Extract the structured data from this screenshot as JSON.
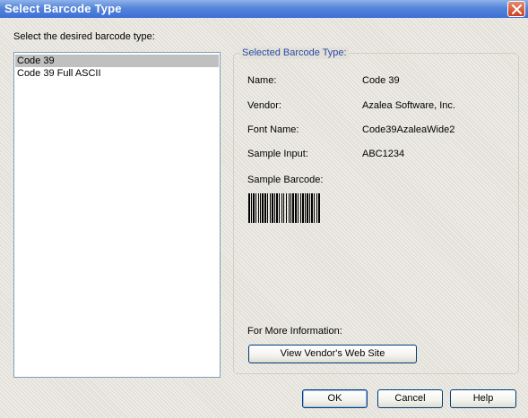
{
  "window": {
    "title": "Select Barcode Type"
  },
  "prompt": "Select the desired barcode type:",
  "barcode_list": {
    "items": [
      "Code 39",
      "Code 39 Full ASCII"
    ],
    "selected_index": 0
  },
  "details": {
    "group_title": "Selected Barcode Type:",
    "name_label": "Name:",
    "name_value": "Code 39",
    "vendor_label": "Vendor:",
    "vendor_value": "Azalea Software, Inc.",
    "font_label": "Font Name:",
    "font_value": "Code39AzaleaWide2",
    "sample_input_label": "Sample Input:",
    "sample_input_value": "ABC1234",
    "sample_barcode_label": "Sample Barcode:",
    "more_info_label": "For More Information:",
    "vendor_site_button": "View Vendor's Web Site"
  },
  "buttons": {
    "ok": "OK",
    "cancel": "Cancel",
    "help": "Help"
  },
  "colors": {
    "title_bar": "#3c6fd6",
    "group_title": "#2a4aa8",
    "selection": "#c0c0c0"
  }
}
